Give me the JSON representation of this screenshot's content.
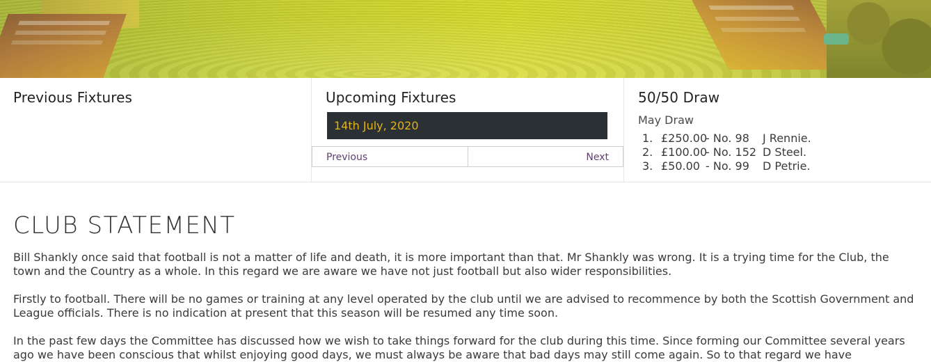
{
  "hero": {
    "image": "stadium-aerial-photo"
  },
  "previous_fixtures": {
    "title": "Previous Fixtures"
  },
  "upcoming_fixtures": {
    "title": "Upcoming Fixtures",
    "date": "14th July, 2020",
    "prev_label": "Previous",
    "next_label": "Next"
  },
  "draw": {
    "title": "50/50 Draw",
    "subtitle": "May Draw",
    "items": [
      {
        "num": "1.",
        "amount": "£250.00",
        "number": "- No. 98",
        "winner": "J Rennie."
      },
      {
        "num": "2.",
        "amount": "£100.00",
        "number": "- No. 152",
        "winner": "D Steel."
      },
      {
        "num": "3.",
        "amount": "£50.00",
        "number": "- No. 99",
        "winner": "D Petrie."
      }
    ]
  },
  "statement": {
    "title": "CLUB STATEMENT",
    "paragraphs": [
      "Bill Shankly once said that football is not a matter of life and death, it is more important than that.  Mr Shankly was wrong.  It is a trying time for the Club, the town and the Country as a whole.  In this regard we are aware we have not just football but also wider responsibilities.",
      "Firstly to football.  There will be no games or training at any level operated by the club until we are advised to recommence by both the Scottish Government and League officials.  There is no indication at present that this season will be resumed any time soon.",
      "In the past few days the Committee has discussed how we wish to take things forward for the club during this time.  Since forming our Committee several years ago we have been conscious that whilst enjoying good days, we must always be aware that bad days may still come again.  So to that regard we have"
    ]
  }
}
